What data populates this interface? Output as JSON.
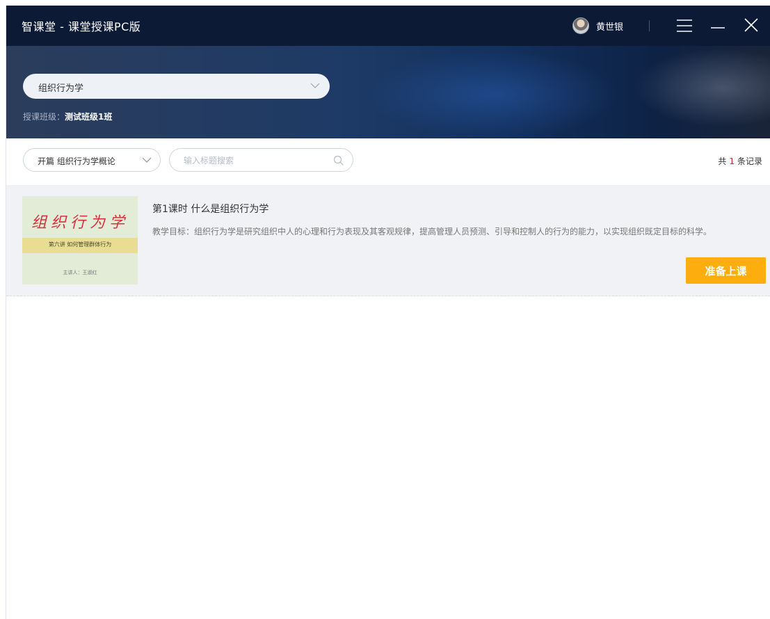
{
  "titlebar": {
    "app_title": "智课堂 - 课堂授课PC版",
    "user_name": "黄世银",
    "icons": [
      "avatar",
      "menu-icon",
      "minimize-icon",
      "close-icon"
    ]
  },
  "banner": {
    "course_select_value": "组织行为学",
    "class_label": "授课班级：",
    "class_value": "测试班级1班"
  },
  "filter": {
    "chapter_select_value": "开篇 组织行为学概论",
    "search_placeholder": "输入标题搜索",
    "records_prefix": "共",
    "records_count": "1",
    "records_suffix": "条记录"
  },
  "lessons": [
    {
      "title": "第1课时 什么是组织行为学",
      "description": "教学目标：组织行为学是研究组织中人的心理和行为表现及其客观规律，提高管理人员预测、引导和控制人的行为的能力，以实现组织既定目标的科学。",
      "thumbnail": {
        "title": "组织行为学",
        "subtitle": "第六讲 如何管理群体行为",
        "author": "主讲人：王淑红"
      },
      "button_label": "准备上课"
    }
  ],
  "colors": {
    "titlebar_bg": "#0d1a35",
    "accent_button": "#fdae0e",
    "record_count": "#e02020"
  }
}
